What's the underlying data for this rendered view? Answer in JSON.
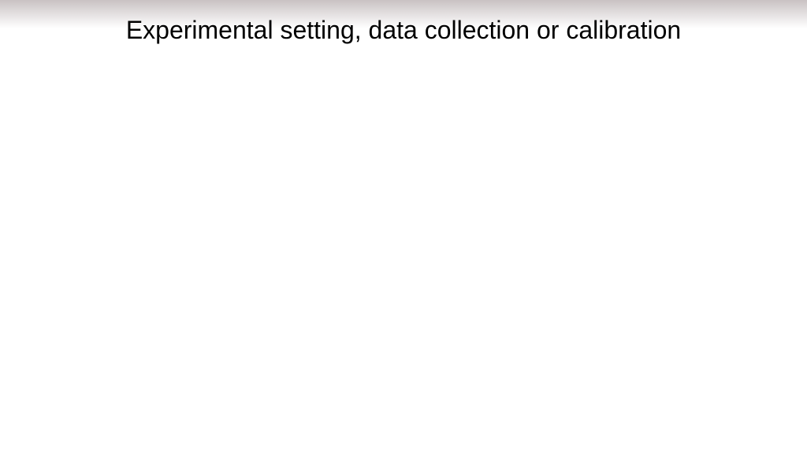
{
  "slide": {
    "title": "Experimental setting, data collection or calibration"
  }
}
